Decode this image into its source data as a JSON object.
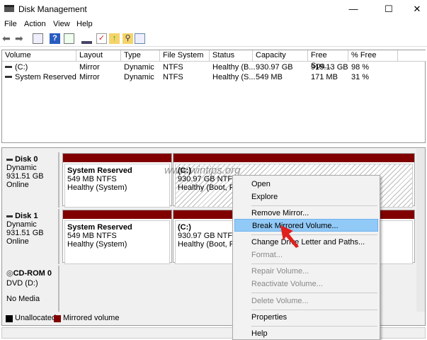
{
  "window": {
    "title": "Disk Management",
    "min": "—",
    "max": "☐",
    "close": "✕"
  },
  "menubar": [
    "File",
    "Action",
    "View",
    "Help"
  ],
  "toolbar": [
    "back-icon",
    "forward-icon",
    "console-tree-icon",
    "help-icon",
    "action-pane-icon",
    "connect-icon",
    "properties-icon",
    "up-folder-icon",
    "search-folder-icon",
    "list-icon"
  ],
  "columns": [
    "Volume",
    "Layout",
    "Type",
    "File System",
    "Status",
    "Capacity",
    "Free Spa...",
    "% Free"
  ],
  "rows": [
    [
      "(C:)",
      "Mirror",
      "Dynamic",
      "NTFS",
      "Healthy (B...",
      "930.97 GB",
      "915.13 GB",
      "98 %"
    ],
    [
      "System Reserved",
      "Mirror",
      "Dynamic",
      "NTFS",
      "Healthy (S...",
      "549 MB",
      "171 MB",
      "31 %"
    ]
  ],
  "disks": [
    {
      "name": "Disk 0",
      "type": "Dynamic",
      "size": "931.51 GB",
      "state": "Online",
      "parts": [
        {
          "name": "System Reserved",
          "fs": "549 MB NTFS",
          "status": "Healthy (System)"
        },
        {
          "name": "(C:)",
          "fs": "930.97 GB NTFS",
          "status": "Healthy (Boot, Pag"
        }
      ]
    },
    {
      "name": "Disk 1",
      "type": "Dynamic",
      "size": "931.51 GB",
      "state": "Online",
      "parts": [
        {
          "name": "System Reserved",
          "fs": "549 MB NTFS",
          "status": "Healthy (System)"
        },
        {
          "name": "(C:)",
          "fs": "930.97 GB NTFS",
          "status": "Healthy (Boot, Pag"
        }
      ]
    }
  ],
  "cdrom": {
    "name": "CD-ROM 0",
    "drive": "DVD (D:)",
    "state": "No Media"
  },
  "legend": [
    {
      "label": "Unallocated",
      "color": "#000000"
    },
    {
      "label": "Mirrored volume",
      "color": "#800000"
    }
  ],
  "watermark": "www.wintips.org",
  "context_menu": [
    "Open",
    "Explore",
    "Remove Mirror...",
    "Break Mirrored Volume...",
    "Change Drive Letter and Paths...",
    "Format...",
    "Repair Volume...",
    "Reactivate Volume...",
    "Delete Volume...",
    "Properties",
    "Help"
  ]
}
